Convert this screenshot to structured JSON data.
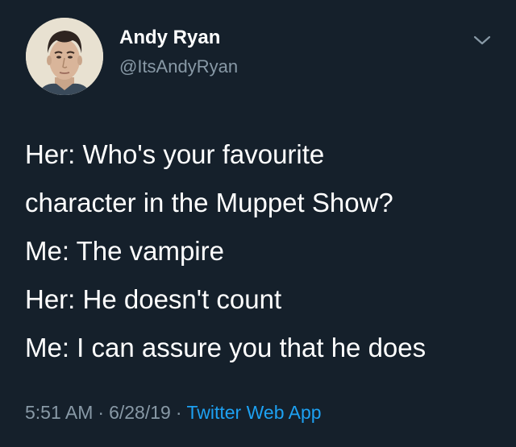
{
  "user": {
    "display_name": "Andy Ryan",
    "handle": "@ItsAndyRyan"
  },
  "tweet": {
    "lines": [
      "Her: Who's your favourite",
      "character in the Muppet Show?",
      "Me: The vampire",
      "Her: He doesn't count",
      "Me: I can assure you that he does"
    ]
  },
  "meta": {
    "time": "5:51 AM",
    "date": "6/28/19",
    "separator": "·",
    "source": "Twitter Web App"
  },
  "icons": {
    "menu": "chevron-down-icon",
    "avatar": "user-avatar"
  },
  "colors": {
    "background": "#15202b",
    "primary_text": "#ffffff",
    "secondary_text": "#8899a6",
    "link": "#1da1f2"
  }
}
